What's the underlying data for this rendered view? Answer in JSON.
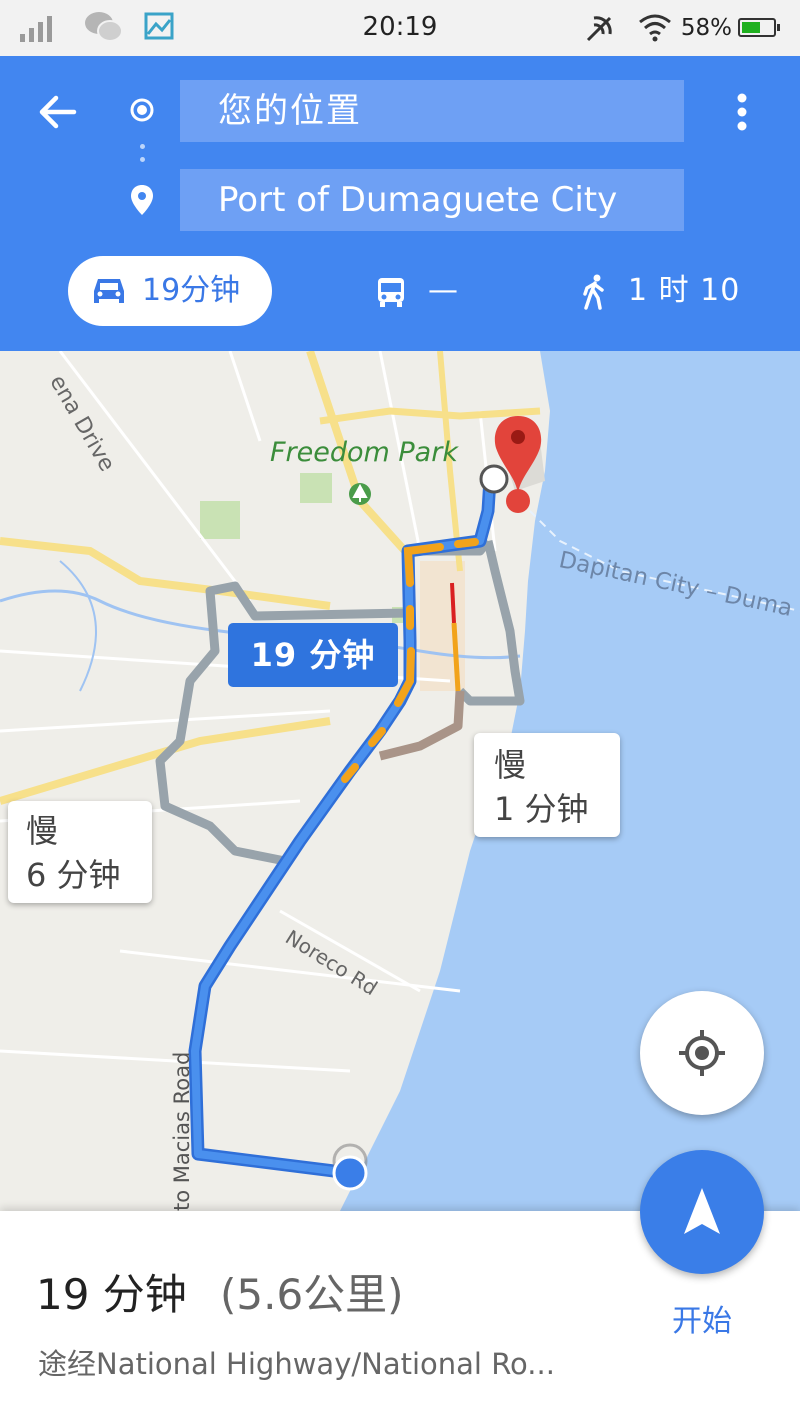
{
  "status_bar": {
    "time": "20:19",
    "battery_percent": "58%",
    "icons": [
      "signal-icon",
      "wechat-icon",
      "gallery-icon",
      "nfc-icon",
      "wifi-icon",
      "battery-icon"
    ]
  },
  "header": {
    "origin": "您的位置",
    "destination": "Port of Dumaguete City",
    "modes": [
      {
        "name": "car",
        "icon": "car-icon",
        "label": "19分钟",
        "selected": true
      },
      {
        "name": "transit",
        "icon": "bus-icon",
        "label": "—",
        "selected": false
      },
      {
        "name": "walk",
        "icon": "walk-icon",
        "label": "1 时 10",
        "selected": false
      }
    ]
  },
  "map": {
    "labels": {
      "freedom_park": "Freedom Park",
      "road_drive": "ena Drive",
      "ferry": "Dapitan City – Duma",
      "noreco": "Noreco Rd",
      "macias": "to Macias Road"
    },
    "route_time": "19 分钟",
    "alt_left": {
      "line1": "慢",
      "line2": "6 分钟"
    },
    "alt_right": {
      "line1": "慢",
      "line2": "1 分钟"
    }
  },
  "summary": {
    "duration": "19 分钟",
    "distance": "(5.6公里)",
    "via": "途经National Highway/National Ro..."
  },
  "start_label": "开始",
  "colors": {
    "header": "#4286f0",
    "route": "#3a7ee8",
    "traffic": "#f2a31b",
    "water": "#a6cbf6",
    "land": "#efeee9"
  }
}
